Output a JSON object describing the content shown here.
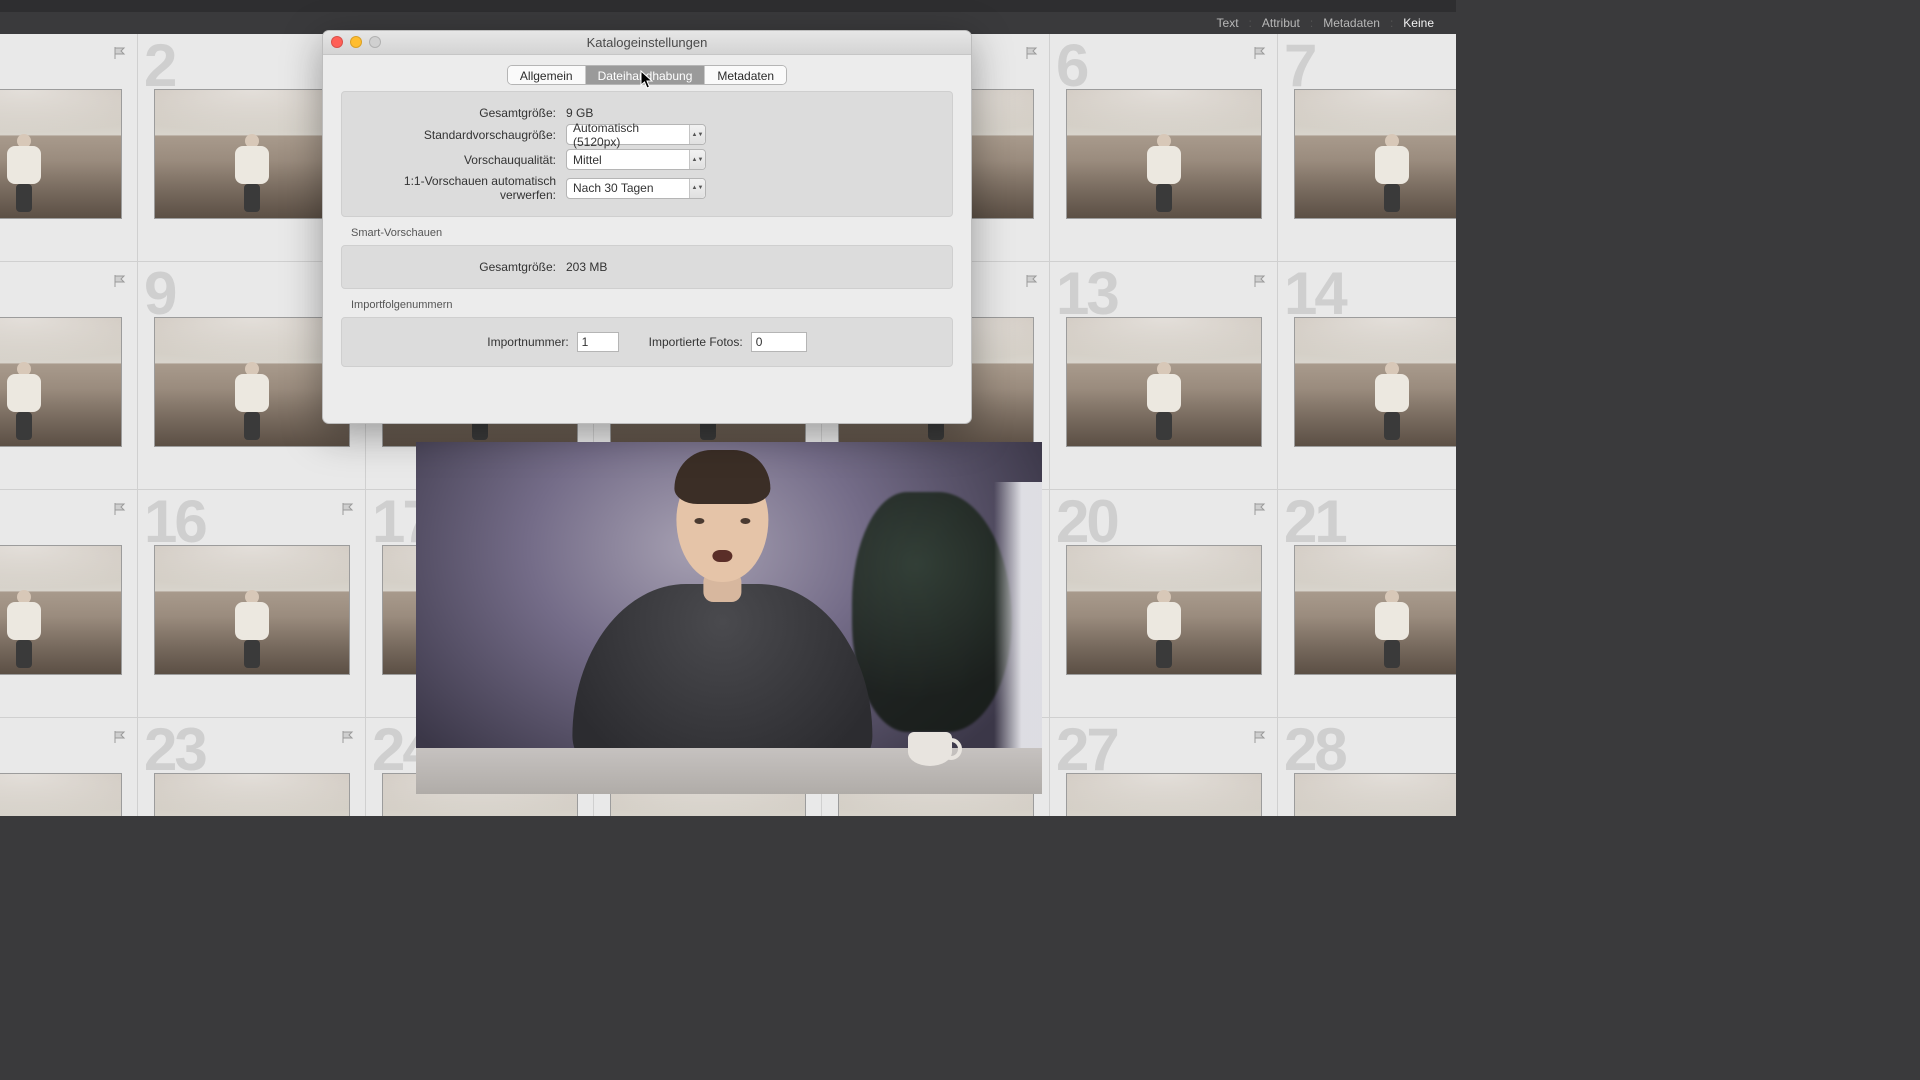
{
  "filter_bar": {
    "items": [
      "Text",
      "Attribut",
      "Metadaten",
      "Keine"
    ],
    "active_index": 3
  },
  "grid": {
    "start_index": 1,
    "columns": 7,
    "rows": 4
  },
  "dialog": {
    "title": "Katalogeinstellungen",
    "tabs": [
      "Allgemein",
      "Dateihandhabung",
      "Metadaten"
    ],
    "active_tab_index": 1,
    "previews": {
      "total_label": "Gesamtgröße:",
      "total_value": "9 GB",
      "std_size_label": "Standardvorschaugröße:",
      "std_size_value": "Automatisch (5120px)",
      "quality_label": "Vorschauqualität:",
      "quality_value": "Mittel",
      "discard_label": "1:1-Vorschauen automatisch verwerfen:",
      "discard_value": "Nach 30 Tagen"
    },
    "smart": {
      "section_label": "Smart-Vorschauen",
      "total_label": "Gesamtgröße:",
      "total_value": "203 MB"
    },
    "import": {
      "section_label": "Importfolgenummern",
      "number_label": "Importnummer:",
      "number_value": "1",
      "photos_label": "Importierte Fotos:",
      "photos_value": "0"
    }
  }
}
